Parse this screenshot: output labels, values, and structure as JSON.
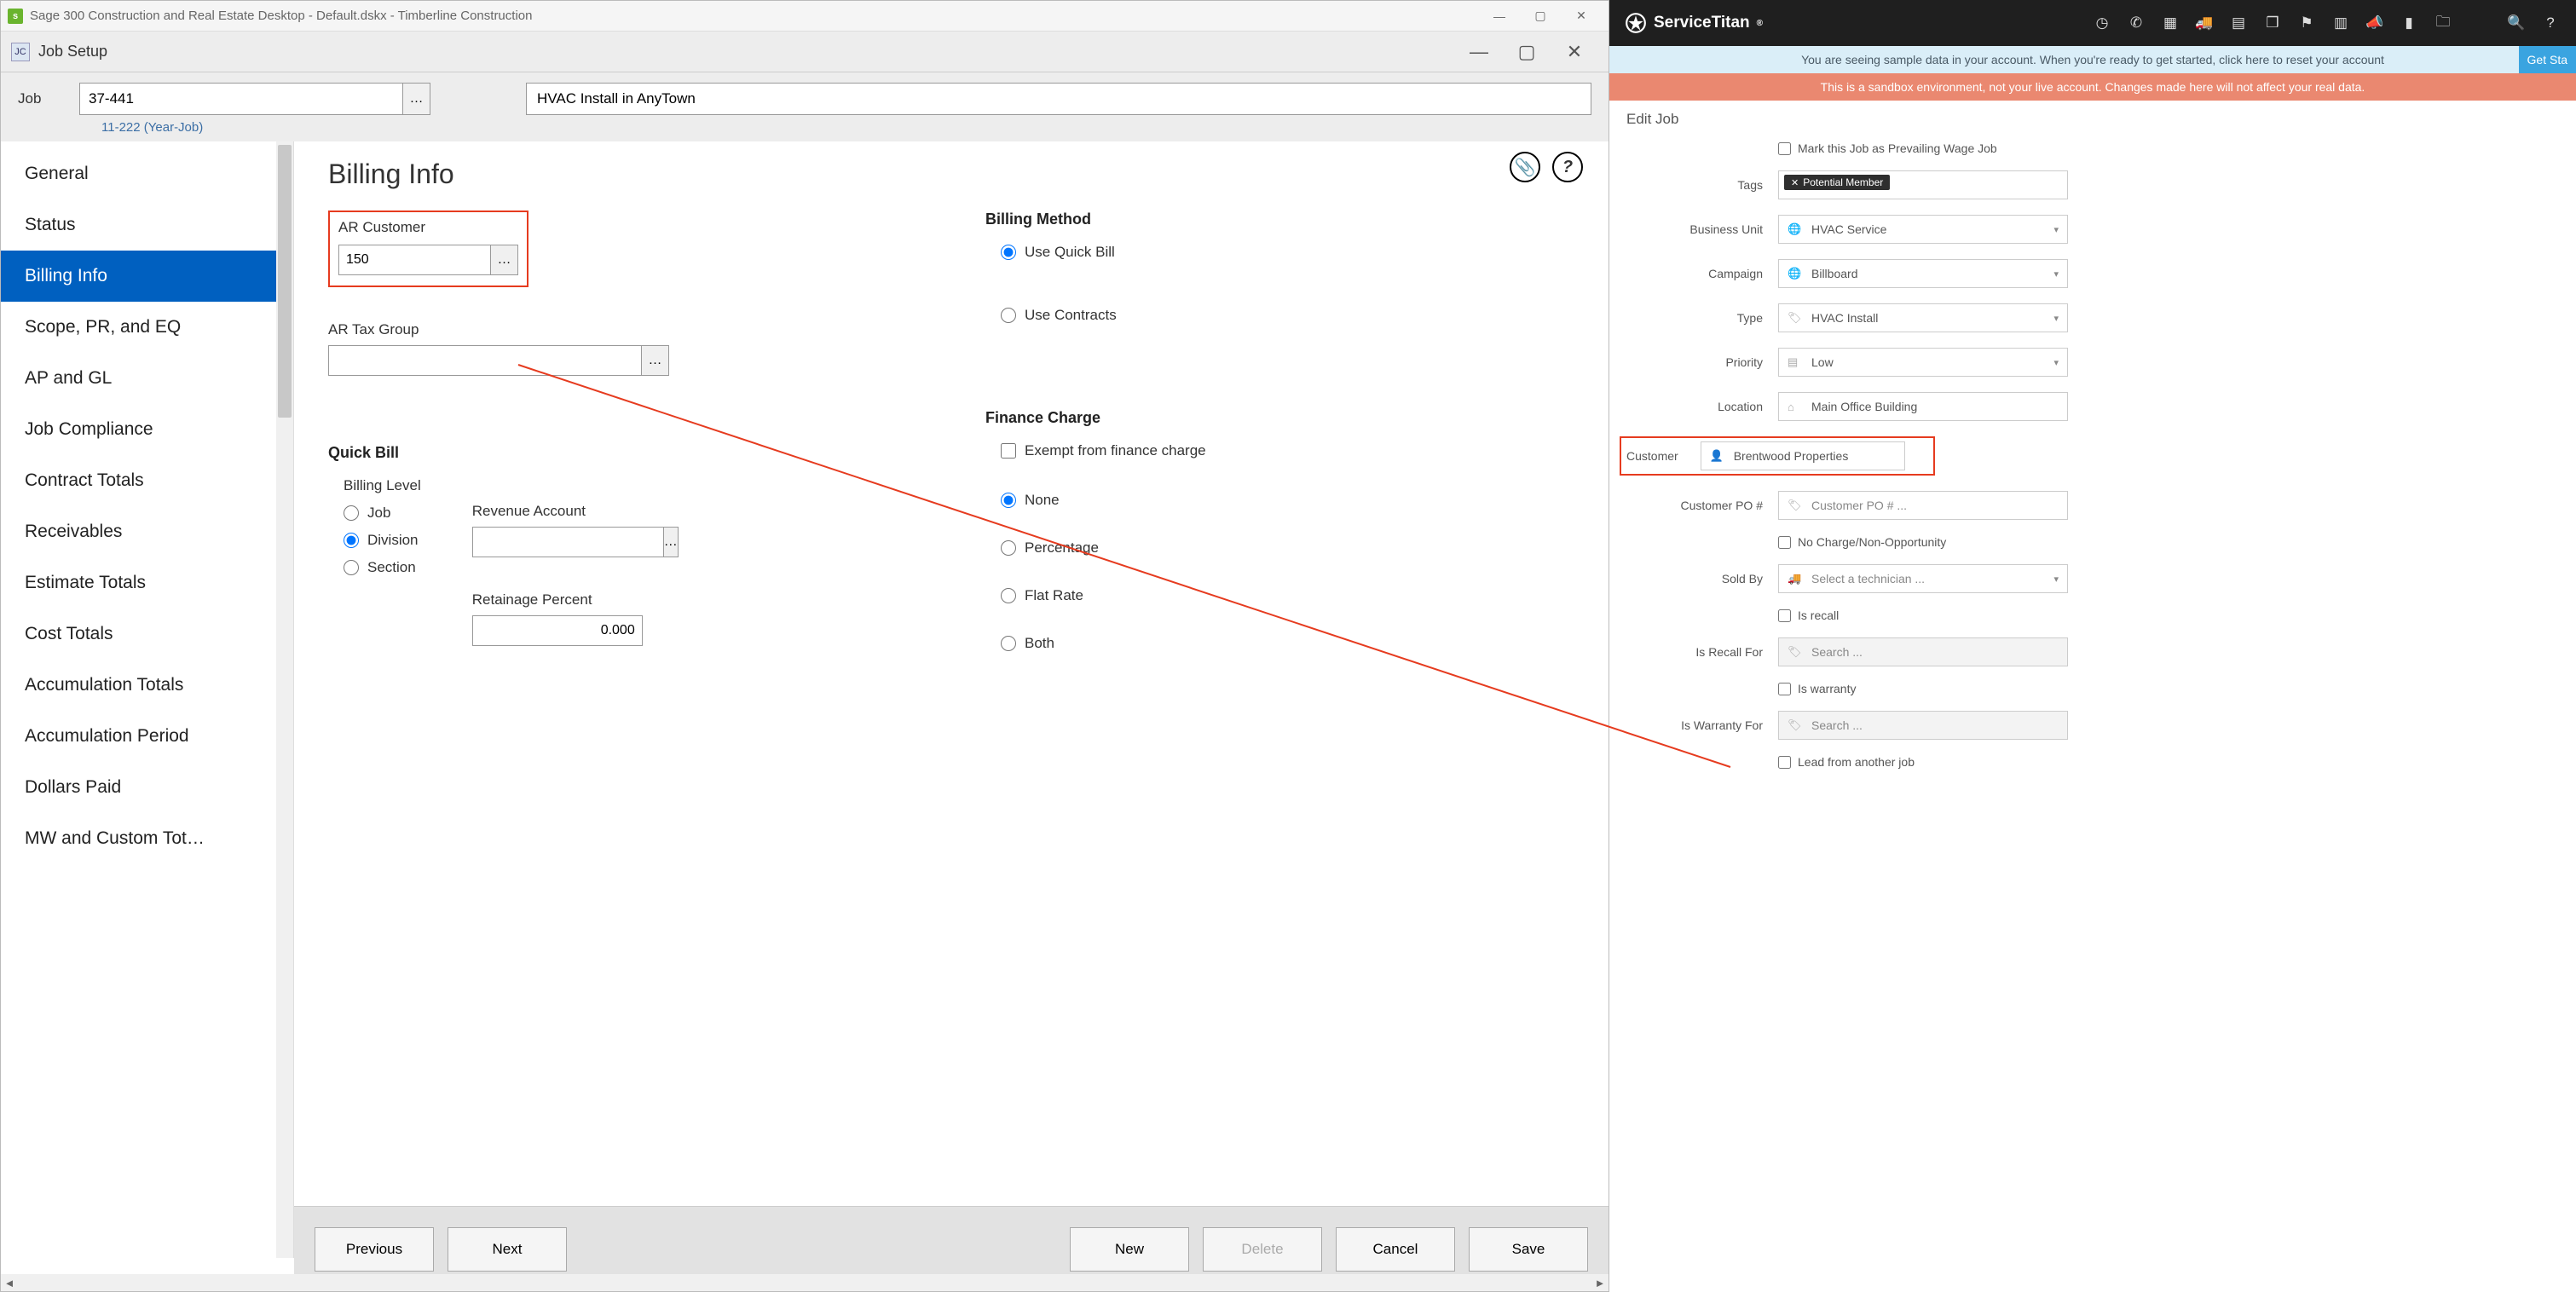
{
  "sage": {
    "outer_title": "Sage 300 Construction and Real Estate Desktop - Default.dskx - Timberline Construction",
    "inner_title": "Job Setup",
    "job_label": "Job",
    "job_number": "37-441",
    "job_hint": "11-222 (Year-Job)",
    "job_desc": "HVAC Install in AnyTown",
    "nav": [
      "General",
      "Status",
      "Billing Info",
      "Scope, PR, and EQ",
      "AP and GL",
      "Job Compliance",
      "Contract Totals",
      "Receivables",
      "Estimate Totals",
      "Cost Totals",
      "Accumulation Totals",
      "Accumulation Period",
      "Dollars Paid",
      "MW and Custom Tot…"
    ],
    "active_nav": "Billing Info",
    "page_title": "Billing Info",
    "ar_customer_label": "AR Customer",
    "ar_customer_value": "150",
    "ar_tax_group_label": "AR Tax Group",
    "billing_method_label": "Billing Method",
    "billing_methods": [
      "Use Quick Bill",
      "Use Contracts"
    ],
    "billing_method_selected": "Use Quick Bill",
    "quickbill_label": "Quick Bill",
    "billing_level_label": "Billing Level",
    "billing_levels": [
      "Job",
      "Division",
      "Section"
    ],
    "billing_level_selected": "Division",
    "revenue_account_label": "Revenue Account",
    "retainage_label": "Retainage Percent",
    "retainage_value": "0.000",
    "finance_charge_label": "Finance Charge",
    "exempt_label": "Exempt from finance charge",
    "finance_options": [
      "None",
      "Percentage",
      "Flat Rate",
      "Both"
    ],
    "finance_selected": "None",
    "buttons": {
      "prev": "Previous",
      "next": "Next",
      "new": "New",
      "delete": "Delete",
      "cancel": "Cancel",
      "save": "Save"
    }
  },
  "st": {
    "brand": "ServiceTitan",
    "banner_blue": "You are seeing sample data in your account. When you're ready to get started, click here to reset your account",
    "get_started": "Get Sta",
    "banner_red": "This is a sandbox environment, not your live account. Changes made here will not affect your real data.",
    "edit_title": "Edit Job",
    "prevailing_label": "Mark this Job as Prevailing Wage Job",
    "tags_label": "Tags",
    "tag_value": "Potential Member",
    "bu_label": "Business Unit",
    "bu_value": "HVAC Service",
    "campaign_label": "Campaign",
    "campaign_value": "Billboard",
    "type_label": "Type",
    "type_value": "HVAC Install",
    "priority_label": "Priority",
    "priority_value": "Low",
    "location_label": "Location",
    "location_value": "Main Office Building",
    "customer_label": "Customer",
    "customer_value": "Brentwood Properties",
    "po_label": "Customer PO #",
    "po_placeholder": "Customer PO # ...",
    "nocharge_label": "No Charge/Non-Opportunity",
    "soldby_label": "Sold By",
    "soldby_value": "Select a technician ...",
    "isrecall_label": "Is recall",
    "recallfor_label": "Is Recall For",
    "search_placeholder": "Search ...",
    "iswarranty_label": "Is warranty",
    "warrantyfor_label": "Is Warranty For",
    "leadfrom_label": "Lead from another job"
  }
}
